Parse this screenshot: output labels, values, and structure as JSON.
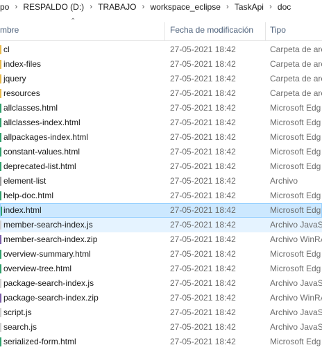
{
  "breadcrumb": [
    "po",
    "RESPALDO (D:)",
    "TRABAJO",
    "workspace_eclipse",
    "TaskApi",
    "doc"
  ],
  "columns": {
    "name": "mbre",
    "date": "Fecha de modificación",
    "type": "Tipo"
  },
  "colors": {
    "selected_bg": "#cce8ff",
    "selected_border": "#99d1ff",
    "hover_bg": "#e5f3ff",
    "header_text": "#4c607a"
  },
  "files": [
    {
      "name": "cl",
      "date": "27-05-2021 18:42",
      "type": "Carpeta de arc",
      "icon": "folder-icon"
    },
    {
      "name": "index-files",
      "date": "27-05-2021 18:42",
      "type": "Carpeta de arc",
      "icon": "folder-icon"
    },
    {
      "name": "jquery",
      "date": "27-05-2021 18:42",
      "type": "Carpeta de arc",
      "icon": "folder-icon"
    },
    {
      "name": "resources",
      "date": "27-05-2021 18:42",
      "type": "Carpeta de arc",
      "icon": "folder-icon"
    },
    {
      "name": "allclasses.html",
      "date": "27-05-2021 18:42",
      "type": "Microsoft Edg",
      "icon": "edge-html-icon"
    },
    {
      "name": "allclasses-index.html",
      "date": "27-05-2021 18:42",
      "type": "Microsoft Edg",
      "icon": "edge-html-icon"
    },
    {
      "name": "allpackages-index.html",
      "date": "27-05-2021 18:42",
      "type": "Microsoft Edg",
      "icon": "edge-html-icon"
    },
    {
      "name": "constant-values.html",
      "date": "27-05-2021 18:42",
      "type": "Microsoft Edg",
      "icon": "edge-html-icon"
    },
    {
      "name": "deprecated-list.html",
      "date": "27-05-2021 18:42",
      "type": "Microsoft Edg",
      "icon": "edge-html-icon"
    },
    {
      "name": "element-list",
      "date": "27-05-2021 18:42",
      "type": "Archivo",
      "icon": "file-icon"
    },
    {
      "name": "help-doc.html",
      "date": "27-05-2021 18:42",
      "type": "Microsoft Edg",
      "icon": "edge-html-icon"
    },
    {
      "name": "index.html",
      "date": "27-05-2021 18:42",
      "type": "Microsoft Edg",
      "icon": "edge-html-icon",
      "state": "selected"
    },
    {
      "name": "member-search-index.js",
      "date": "27-05-2021 18:42",
      "type": "Archivo JavaSc",
      "icon": "js-file-icon",
      "state": "hover"
    },
    {
      "name": "member-search-index.zip",
      "date": "27-05-2021 18:42",
      "type": "Archivo WinRA",
      "icon": "zip-file-icon"
    },
    {
      "name": "overview-summary.html",
      "date": "27-05-2021 18:42",
      "type": "Microsoft Edg",
      "icon": "edge-html-icon"
    },
    {
      "name": "overview-tree.html",
      "date": "27-05-2021 18:42",
      "type": "Microsoft Edg",
      "icon": "edge-html-icon"
    },
    {
      "name": "package-search-index.js",
      "date": "27-05-2021 18:42",
      "type": "Archivo JavaSc",
      "icon": "js-file-icon"
    },
    {
      "name": "package-search-index.zip",
      "date": "27-05-2021 18:42",
      "type": "Archivo WinRA",
      "icon": "zip-file-icon"
    },
    {
      "name": "script.js",
      "date": "27-05-2021 18:42",
      "type": "Archivo JavaSc",
      "icon": "js-file-icon"
    },
    {
      "name": "search.js",
      "date": "27-05-2021 18:42",
      "type": "Archivo JavaSc",
      "icon": "js-file-icon"
    },
    {
      "name": "serialized-form.html",
      "date": "27-05-2021 18:42",
      "type": "Microsoft Edg",
      "icon": "edge-html-icon"
    }
  ]
}
